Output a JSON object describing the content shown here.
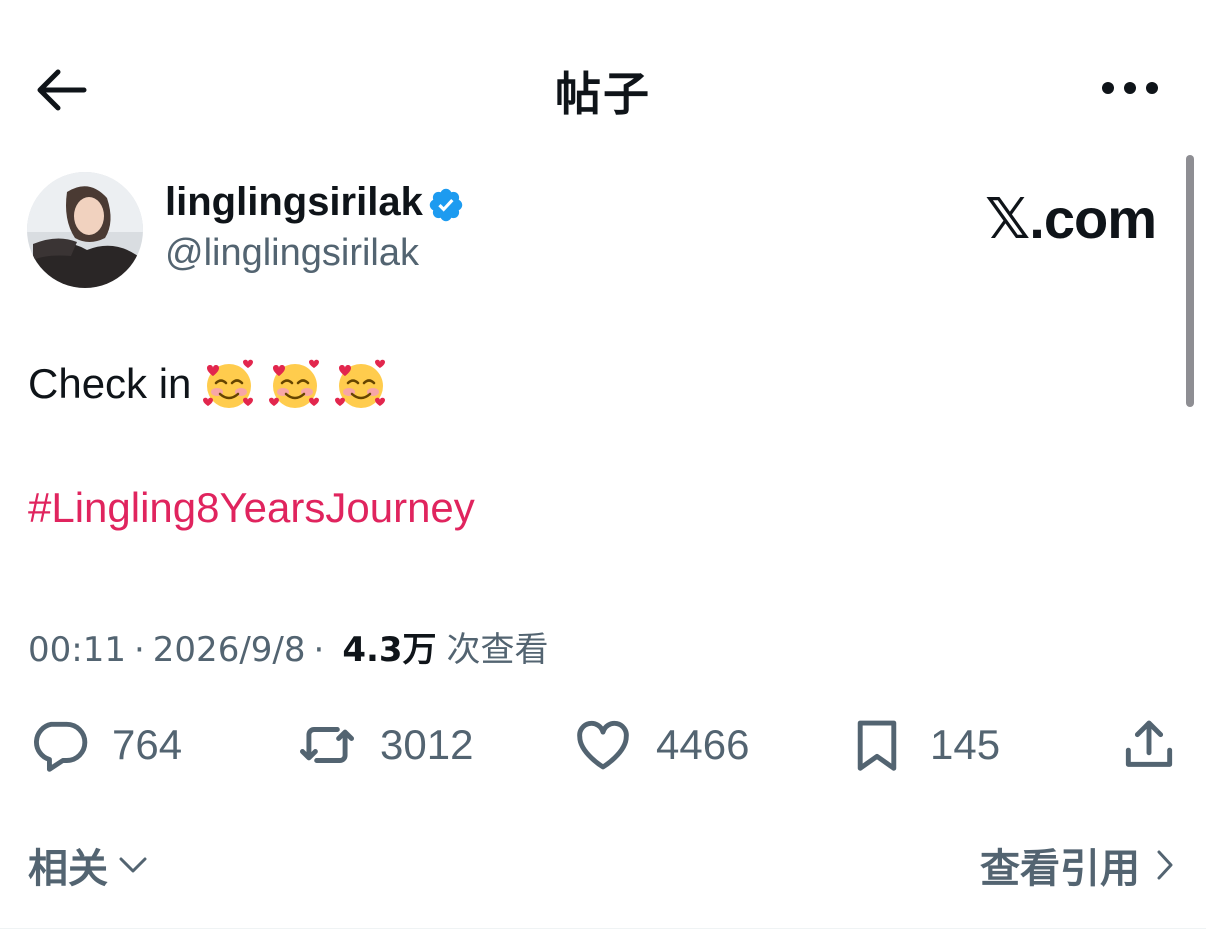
{
  "header": {
    "title": "帖子",
    "back_icon": "arrow-left-icon",
    "more_icon": "more-horizontal-icon"
  },
  "author": {
    "display_name": "linglingsirilak",
    "handle": "@linglingsirilak",
    "verified": true,
    "verified_color": "#1d9bf0"
  },
  "brand": {
    "text": "𝕏.com"
  },
  "post": {
    "text": "Check in",
    "emojis": [
      "smiling-face-with-hearts",
      "smiling-face-with-hearts",
      "smiling-face-with-hearts"
    ],
    "hashtag": "#Lingling8YearsJourney",
    "hashtag_color": "#e0245e"
  },
  "meta": {
    "time": "00:11",
    "date": "2026/9/8",
    "separator": "·",
    "views_count": "4.3万",
    "views_label": "次查看"
  },
  "actions": {
    "replies": "764",
    "reposts": "3012",
    "likes": "4466",
    "bookmarks": "145"
  },
  "footer": {
    "related_label": "相关",
    "quotes_label": "查看引用"
  }
}
